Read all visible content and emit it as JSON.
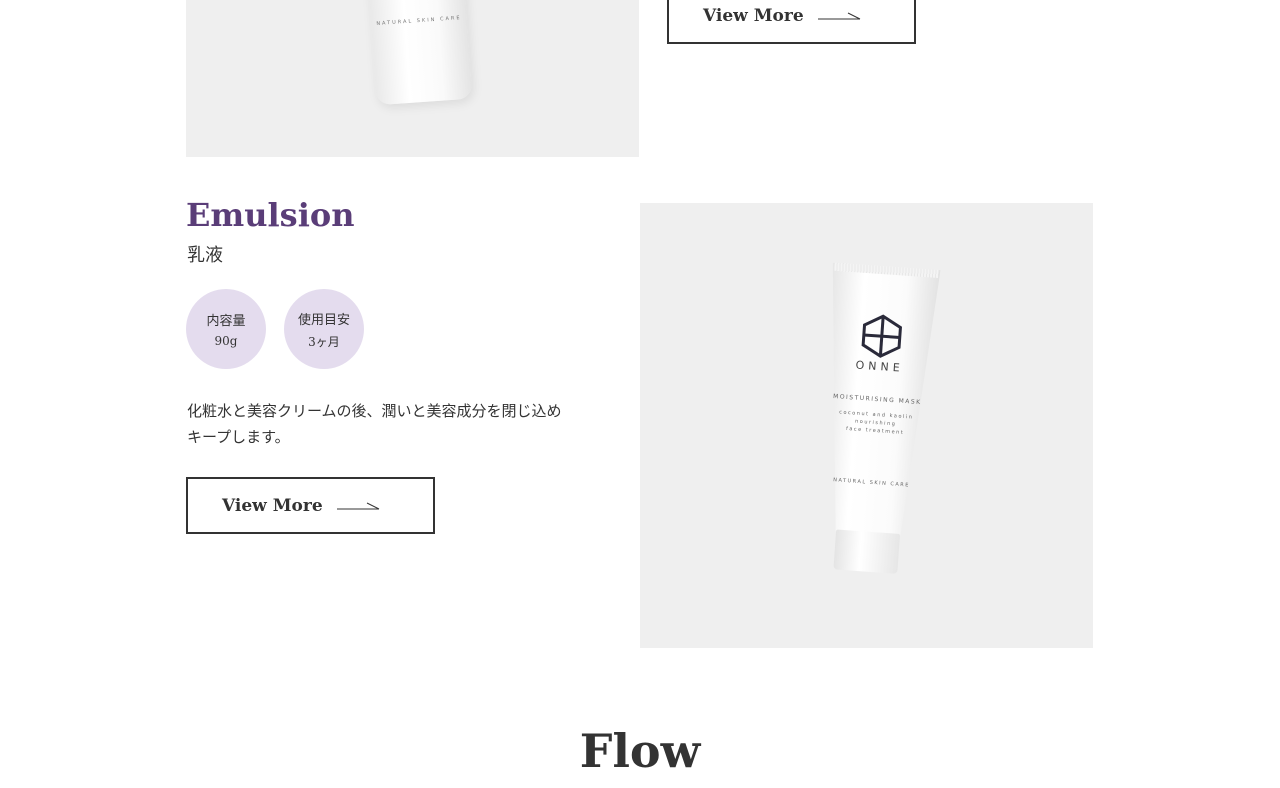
{
  "previous_product": {
    "image_alt": "Natural skin care bottle",
    "bottle_text": "NATURAL SKIN CARE",
    "view_more": "View More"
  },
  "emulsion": {
    "title": "Emulsion",
    "subtitle": "乳液",
    "specs": [
      {
        "label": "内容量",
        "value": "90g"
      },
      {
        "label": "使用目安",
        "value": "3ヶ月"
      }
    ],
    "description_line1": "化粧水と美容クリームの後、潤いと美容成分を閉じ込め",
    "description_line2": "キープします。",
    "view_more": "View More",
    "tube": {
      "brand": "ONNE",
      "product": "MOISTURISING MASK",
      "tagline1": "coconut and kaolin",
      "tagline2": "nourishing",
      "tagline3": "face treatment",
      "footer": "NATURAL SKIN CARE"
    }
  },
  "colors": {
    "accent_purple": "#5a3d78",
    "circle_bg": "#e4dcee",
    "image_bg": "#efefef"
  },
  "icons": {
    "arrow": "arrow-right-icon",
    "logo": "hexagon-logo-icon"
  },
  "section_heading": "Flow"
}
